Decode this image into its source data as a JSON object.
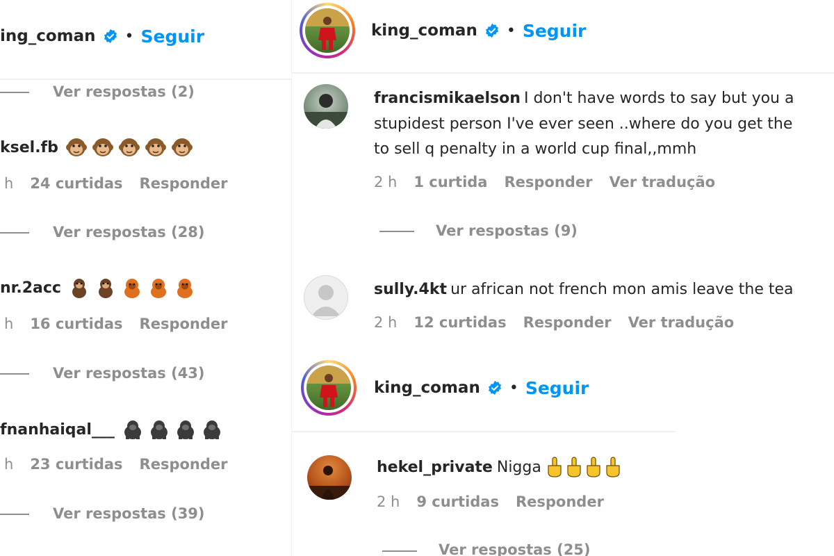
{
  "left": {
    "header": {
      "username": "ing_coman",
      "separator": "•",
      "follow_label": "Seguir"
    },
    "threads": [
      {
        "replies": "Ver respostas (2)"
      },
      {
        "username": "ksel.fb",
        "emoji_name": "monkey-face-emoji",
        "emoji_count": 5,
        "time": "h",
        "likes": "24 curtidas",
        "reply_label": "Responder",
        "replies": "Ver respostas (28)"
      },
      {
        "username": "nr.2acc",
        "emoji_name": "monkey-orangutan-emoji",
        "emoji_count": 5,
        "time": "h",
        "likes": "16 curtidas",
        "reply_label": "Responder",
        "replies": "Ver respostas (43)"
      },
      {
        "username": "fnanhaiqal___",
        "emoji_name": "gorilla-emoji",
        "emoji_count": 4,
        "time": "h",
        "likes": "23 curtidas",
        "reply_label": "Responder",
        "replies": "Ver respostas (39)"
      }
    ]
  },
  "right": {
    "header": {
      "username": "king_coman",
      "separator": "•",
      "follow_label": "Seguir"
    },
    "comments": [
      {
        "username": "francismikaelson",
        "lines": [
          "I don't have words to say but you a",
          "stupidest person I've ever seen ..where do you get the",
          "to sell q penalty in a world cup final,,mmh"
        ],
        "time": "2 h",
        "likes": "1 curtida",
        "reply_label": "Responder",
        "translate_label": "Ver tradução",
        "replies": "Ver respostas (9)"
      },
      {
        "username": "sully.4kt",
        "text": "ur african not french mon amis leave the tea",
        "time": "2 h",
        "likes": "12 curtidas",
        "reply_label": "Responder",
        "translate_label": "Ver tradução"
      }
    ],
    "post2": {
      "header": {
        "username": "king_coman",
        "separator": "•",
        "follow_label": "Seguir"
      },
      "comment": {
        "username": "hekel_private",
        "text": "Nigga",
        "emoji_name": "middle-finger-emoji",
        "emoji_count": 4,
        "time": "2 h",
        "likes": "9 curtidas",
        "reply_label": "Responder",
        "replies": "Ver respostas (25)"
      }
    }
  },
  "colors": {
    "link": "#0095f6",
    "muted": "#8e8e8e",
    "text": "#262626",
    "verified": "#0095f6"
  }
}
